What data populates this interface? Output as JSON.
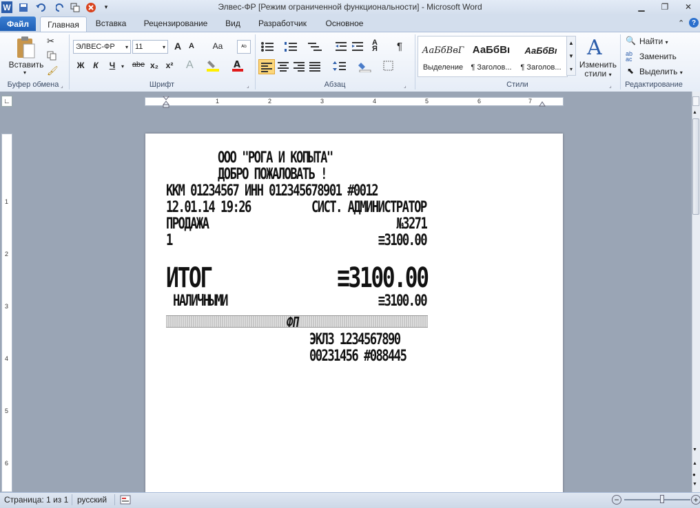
{
  "window": {
    "title": "Элвес-ФР [Режим ограниченной функциональности]  -  Microsoft Word",
    "app_icon": "W"
  },
  "tabs": [
    "Файл",
    "Главная",
    "Вставка",
    "Рецензирование",
    "Вид",
    "Разработчик",
    "Основное"
  ],
  "ribbon": {
    "clipboard": {
      "paste": "Вставить",
      "group": "Буфер обмена"
    },
    "font": {
      "name": "ЭЛВЕС-ФР",
      "size": "11",
      "group": "Шрифт",
      "bold": "Ж",
      "italic": "К",
      "underline": "Ч",
      "strike": "abe",
      "sub": "x₂",
      "sup": "x²",
      "grow": "A",
      "shrink": "A",
      "case": "Aa"
    },
    "paragraph": {
      "group": "Абзац",
      "pilcrow": "¶"
    },
    "styles": {
      "group": "Стили",
      "items": [
        {
          "preview": "АаБбВвГ",
          "label": "Выделение"
        },
        {
          "preview": "АаБбВı",
          "label": "¶ Заголов..."
        },
        {
          "preview": "АаБбВı",
          "label": "¶ Заголов..."
        }
      ],
      "change_label_1": "Изменить",
      "change_label_2": "стили"
    },
    "editing": {
      "group": "Редактирование",
      "find": "Найти",
      "replace": "Заменить",
      "select": "Выделить"
    }
  },
  "receipt": {
    "line1": "ООО \"РОГА И КОПЫТА\"",
    "line2": "ДОБРО ПОЖАЛОВАТЬ !",
    "line3": "ККМ 01234567 ИНН 012345678901 #0012",
    "line4_left": "12.01.14 19:26",
    "line4_right": "СИСТ. АДМИНИСТРАТОР",
    "line5_left": "ПРОДАЖА",
    "line5_right": "№3271",
    "line6_left": "1",
    "line6_right": "≡3100.00",
    "total_label": "ИТОГ",
    "total_value": "≡3100.00",
    "cash_label": "НАЛИЧНЫМИ",
    "cash_value": "≡3100.00",
    "fp": "ФП",
    "eklz1": "ЭКЛЗ 1234567890",
    "eklz2": "00231456 #088445"
  },
  "ruler": {
    "h": [
      "1",
      "2",
      "3",
      "4",
      "5",
      "6",
      "7"
    ],
    "v": [
      "1",
      "2",
      "3",
      "4",
      "5",
      "6"
    ]
  },
  "status": {
    "page": "Страница: 1 из 1",
    "lang": "русский"
  }
}
